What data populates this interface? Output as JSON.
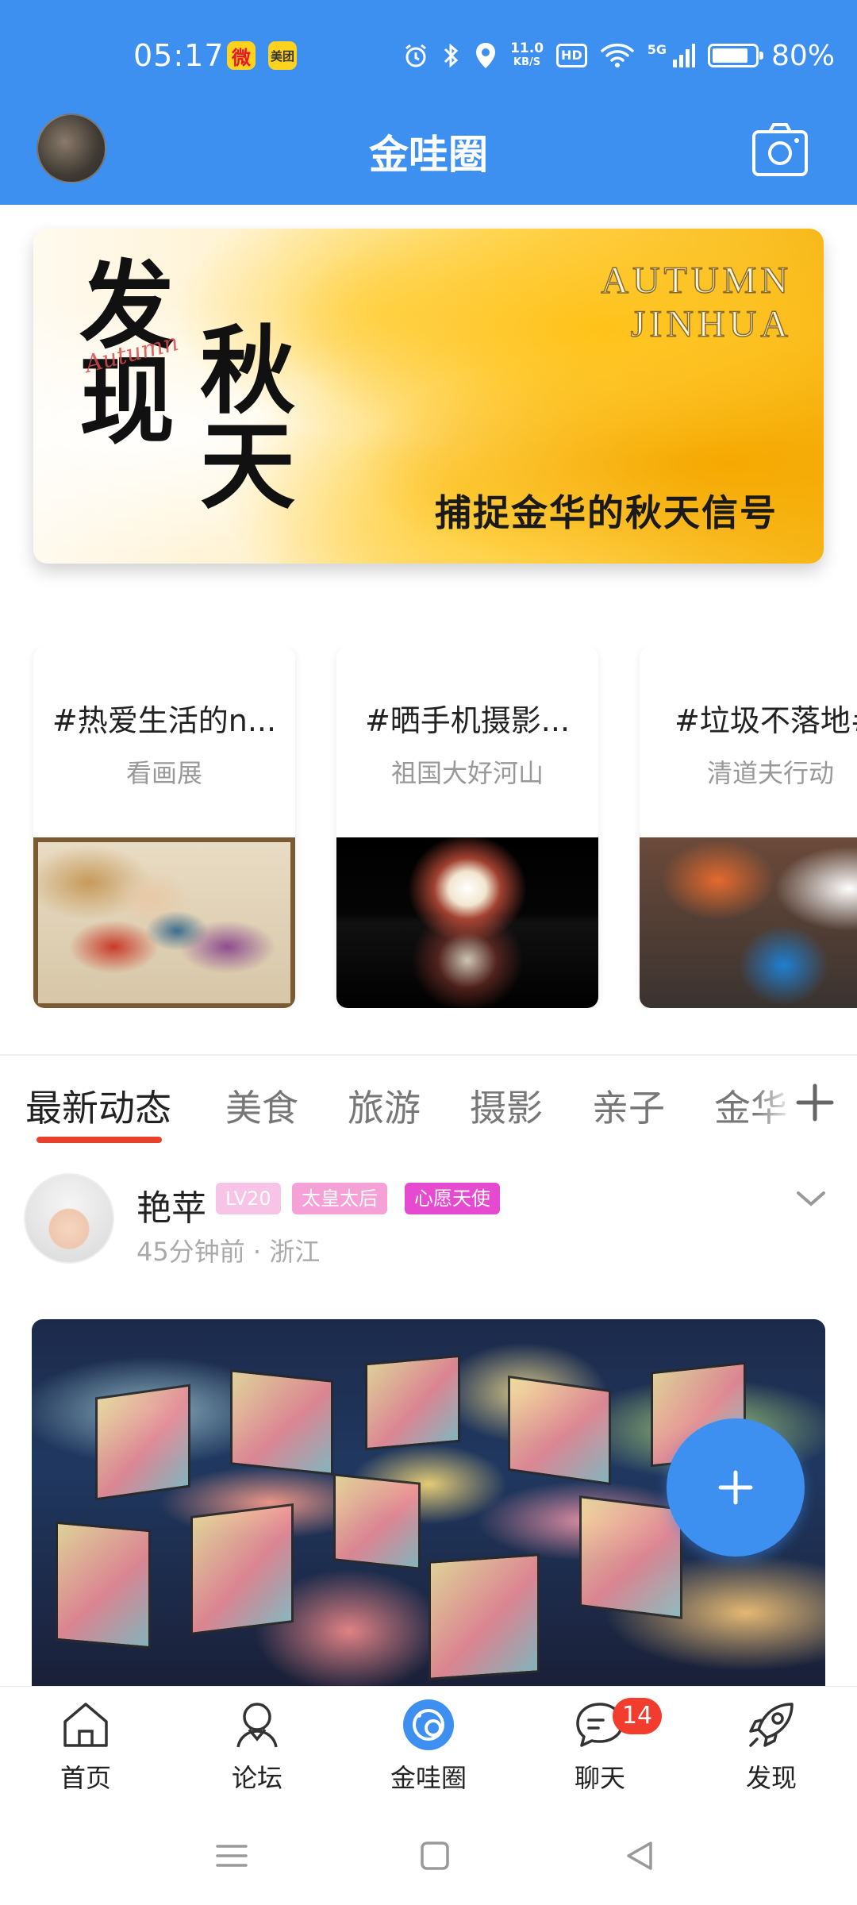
{
  "status_bar": {
    "time": "05:17",
    "apps": [
      "微",
      "美团"
    ],
    "net_speed_value": "11.0",
    "net_speed_unit": "KB/S",
    "hd": "HD",
    "signal_label": "5G",
    "battery_percent": 80,
    "battery_text": "80%"
  },
  "header": {
    "title": "金哇圈",
    "camera_icon": "camera-icon"
  },
  "banner": {
    "title_left": "发现",
    "title_right": "秋天",
    "script_text": "Autumn",
    "english_line1": "AUTUMN",
    "english_line2": "JINHUA",
    "slogan": "捕捉金华的秋天信号"
  },
  "topics": [
    {
      "title": "#热爱生活的n...",
      "subtitle": "看画展"
    },
    {
      "title": "#晒手机摄影...",
      "subtitle": "祖国大好河山"
    },
    {
      "title": "#垃圾不落地#",
      "subtitle": "清道夫行动"
    }
  ],
  "tabs": {
    "items": [
      "最新动态",
      "美食",
      "旅游",
      "摄影",
      "亲子",
      "金华"
    ],
    "active_index": 0,
    "add_icon": "plus-icon"
  },
  "post": {
    "username": "艳苹",
    "level": "LV20",
    "title_badge_1": "太皇太后",
    "title_badge_2": "心愿天使",
    "meta": "45分钟前 · 浙江"
  },
  "fab": {
    "icon": "plus-icon"
  },
  "bottom_nav": {
    "items": [
      {
        "label": "首页",
        "icon": "home-icon"
      },
      {
        "label": "论坛",
        "icon": "forum-icon"
      },
      {
        "label": "金哇圈",
        "icon": "circle-icon"
      },
      {
        "label": "聊天",
        "icon": "chat-icon",
        "badge": "14"
      },
      {
        "label": "发现",
        "icon": "rocket-icon"
      }
    ],
    "active_index": 2
  },
  "colors": {
    "primary": "#3d8ff0",
    "tab_indicator": "#e8412b",
    "badge_red": "#f23c2e",
    "badge_lv": "#f7c3e6",
    "badge_pink": "#f6a0d8",
    "badge_magenta": "#e64ad1"
  }
}
